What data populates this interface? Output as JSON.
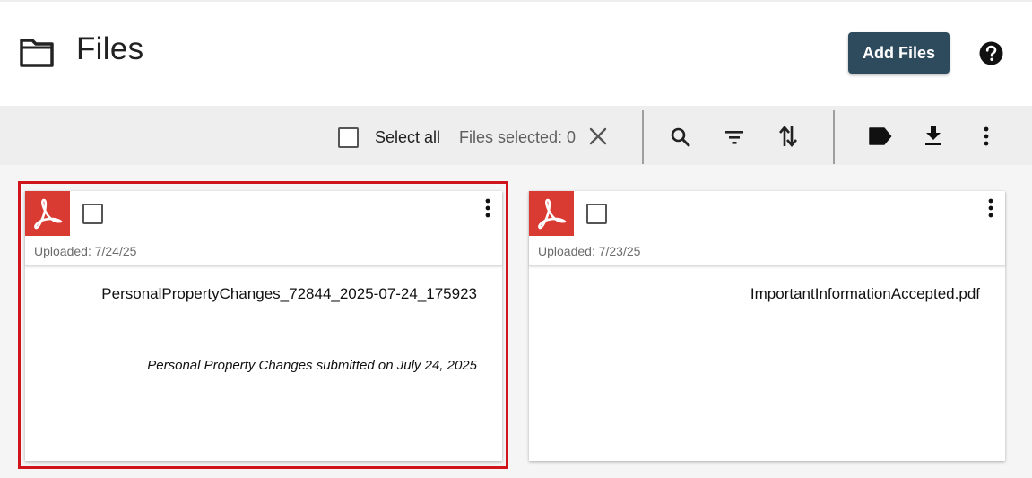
{
  "header": {
    "title": "Files",
    "add_files_label": "Add Files",
    "folder_icon": "folder-icon",
    "help_icon": "help-icon"
  },
  "toolbar": {
    "select_all_label": "Select all",
    "files_selected_text": "Files selected: 0",
    "icons": [
      "clear-selection-icon",
      "search-icon",
      "filter-icon",
      "sort-icon",
      "tag-icon",
      "download-icon",
      "more-vert-icon"
    ]
  },
  "files": [
    {
      "uploaded": "Uploaded: 7/24/25",
      "name": "PersonalPropertyChanges_72844_2025-07-24_175923",
      "description": "Personal Property Changes submitted on July 24, 2025",
      "selected": false,
      "highlighted": true
    },
    {
      "uploaded": "Uploaded: 7/23/25",
      "name": "ImportantInformationAccepted.pdf",
      "description": "",
      "selected": false,
      "highlighted": false
    }
  ],
  "colors": {
    "primary_button": "#2e4b5e",
    "pdf_badge": "#d93a32",
    "highlight_border": "#d0141c",
    "toolbar_bg": "#eeeeee"
  }
}
